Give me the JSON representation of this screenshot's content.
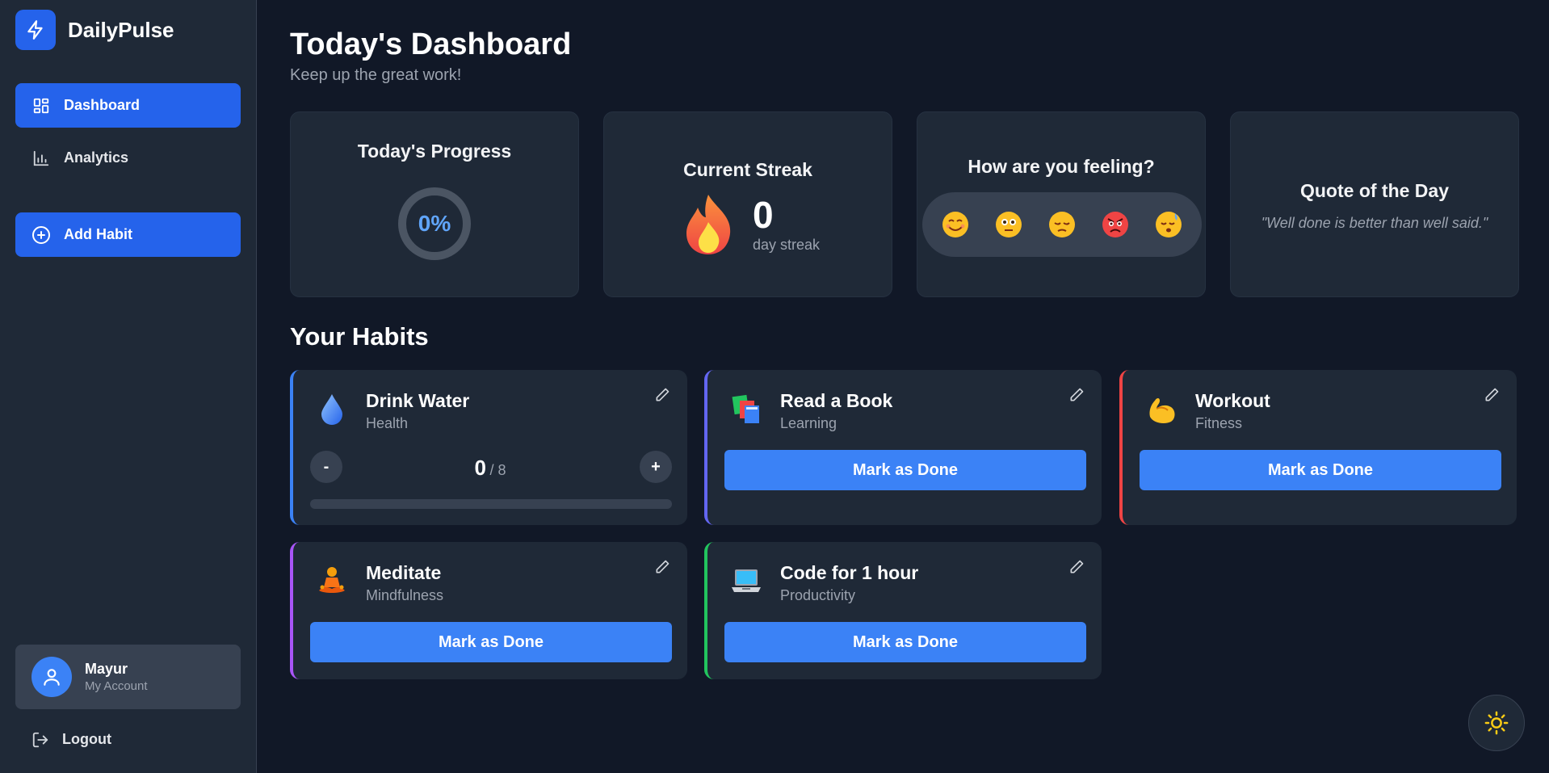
{
  "brand": {
    "name": "DailyPulse",
    "icon": "bolt-icon"
  },
  "sidebar": {
    "nav": [
      {
        "label": "Dashboard",
        "icon": "grid-icon",
        "active": true
      },
      {
        "label": "Analytics",
        "icon": "bar-chart-icon",
        "active": false
      }
    ],
    "add_habit_label": "Add Habit",
    "account": {
      "name": "Mayur",
      "subtitle": "My Account"
    },
    "logout_label": "Logout"
  },
  "header": {
    "title": "Today's Dashboard",
    "subtitle": "Keep up the great work!"
  },
  "stats": {
    "progress": {
      "title": "Today's Progress",
      "value": "0%",
      "fraction": 0
    },
    "streak": {
      "title": "Current Streak",
      "value": "0",
      "label": "day streak"
    },
    "mood": {
      "title": "How are you feeling?",
      "options": [
        "smiling-face",
        "flushed-face",
        "pensive-face",
        "angry-face",
        "sleeping-face"
      ]
    },
    "quote": {
      "title": "Quote of the Day",
      "text": "\"Well done is better than well said.\""
    }
  },
  "habits_title": "Your Habits",
  "habits": [
    {
      "name": "Drink Water",
      "category": "Health",
      "icon": "droplet-icon",
      "color": "#3b82f6",
      "type": "counter",
      "current": "0",
      "target": "/ 8",
      "progress": 0
    },
    {
      "name": "Read a Book",
      "category": "Learning",
      "icon": "books-icon",
      "color": "#6366f1",
      "type": "button",
      "button_label": "Mark as Done"
    },
    {
      "name": "Workout",
      "category": "Fitness",
      "icon": "flexed-biceps-icon",
      "color": "#ef4444",
      "type": "button",
      "button_label": "Mark as Done"
    },
    {
      "name": "Meditate",
      "category": "Mindfulness",
      "icon": "meditation-icon",
      "color": "#a855f7",
      "type": "button",
      "button_label": "Mark as Done"
    },
    {
      "name": "Code for 1 hour",
      "category": "Productivity",
      "icon": "laptop-icon",
      "color": "#22c55e",
      "type": "button",
      "button_label": "Mark as Done"
    }
  ],
  "counter": {
    "minus": "-",
    "plus": "+"
  },
  "theme_toggle": {
    "icon": "sun-icon",
    "color": "#facc15"
  },
  "colors": {
    "accent": "#2563eb",
    "button": "#3b82f6",
    "background": "#111827",
    "card": "#1f2937"
  }
}
